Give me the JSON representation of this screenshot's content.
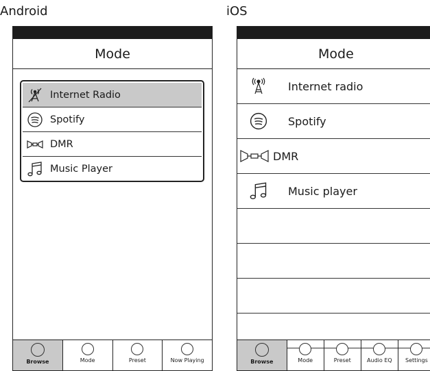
{
  "android": {
    "platform_label": "Android",
    "title": "Mode",
    "items": [
      {
        "label": "Internet Radio",
        "icon": "radio-tower-crossed-icon",
        "selected": true
      },
      {
        "label": "Spotify",
        "icon": "spotify-icon",
        "selected": false
      },
      {
        "label": "DMR",
        "icon": "dmr-icon",
        "selected": false
      },
      {
        "label": "Music Player",
        "icon": "music-note-icon",
        "selected": false
      }
    ],
    "tabs": [
      {
        "label": "Browse",
        "active": true
      },
      {
        "label": "Mode",
        "active": false
      },
      {
        "label": "Preset",
        "active": false
      },
      {
        "label": "Now Playing",
        "active": false
      }
    ]
  },
  "ios": {
    "platform_label": "iOS",
    "title": "Mode",
    "items": [
      {
        "label": "Internet radio",
        "icon": "radio-tower-icon"
      },
      {
        "label": "Spotify",
        "icon": "spotify-icon"
      },
      {
        "label": "DMR",
        "icon": "dmr-icon"
      },
      {
        "label": "Music player",
        "icon": "music-note-icon"
      }
    ],
    "tabs": [
      {
        "label": "Browse",
        "active": true
      },
      {
        "label": "Mode",
        "active": false
      },
      {
        "label": "Preset",
        "active": false
      },
      {
        "label": "Audio EQ",
        "active": false
      },
      {
        "label": "Settings",
        "active": false
      }
    ]
  }
}
